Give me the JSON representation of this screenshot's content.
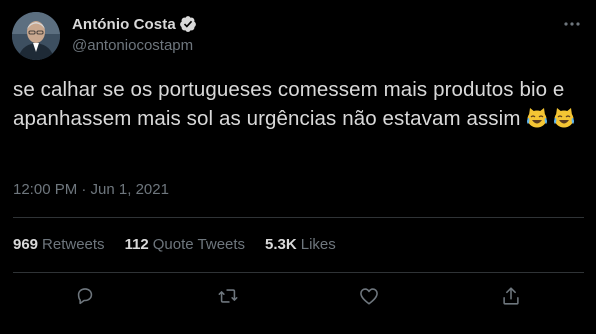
{
  "author": {
    "display_name": "António Costa",
    "handle": "@antoniocostapm",
    "verified": true,
    "avatar_icon": "profile-photo"
  },
  "tweet": {
    "text": "se calhar se os portugueses comessem mais produtos bio e apanhassem mais sol as urgências não estavam assim",
    "emojis": [
      "face-with-tears-of-joy-cat-icon",
      "face-with-tears-of-joy-cat-icon"
    ],
    "timestamp": "12:00 PM · Jun 1, 2021"
  },
  "stats": [
    {
      "count": "969",
      "label": "Retweets"
    },
    {
      "count": "112",
      "label": "Quote Tweets"
    },
    {
      "count": "5.3K",
      "label": "Likes"
    }
  ],
  "actions": [
    {
      "icon": "reply-icon"
    },
    {
      "icon": "retweet-icon"
    },
    {
      "icon": "like-icon"
    },
    {
      "icon": "share-icon"
    }
  ],
  "colors": {
    "background": "#000000",
    "text": "#d9d9d9",
    "muted": "#6e767d",
    "divider": "#2f3336",
    "verified": "#d9d9d9"
  }
}
